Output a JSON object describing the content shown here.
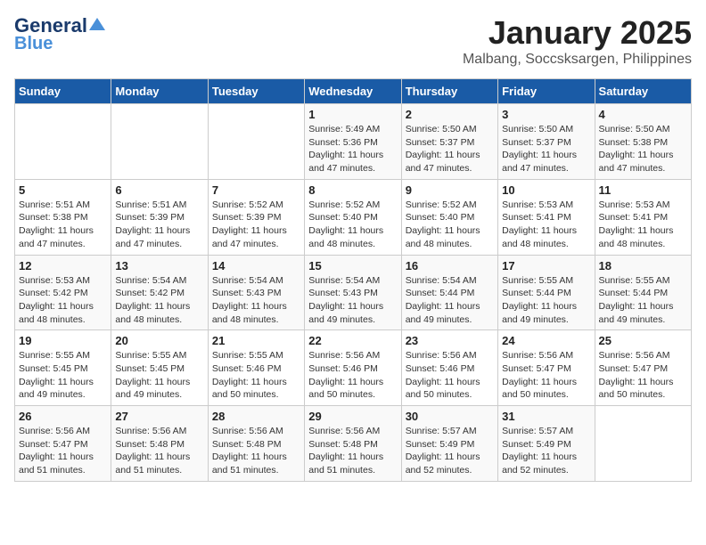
{
  "logo": {
    "part1": "General",
    "part2": "Blue"
  },
  "title": "January 2025",
  "subtitle": "Malbang, Soccsksargen, Philippines",
  "weekdays": [
    "Sunday",
    "Monday",
    "Tuesday",
    "Wednesday",
    "Thursday",
    "Friday",
    "Saturday"
  ],
  "weeks": [
    [
      {
        "day": "",
        "info": ""
      },
      {
        "day": "",
        "info": ""
      },
      {
        "day": "",
        "info": ""
      },
      {
        "day": "1",
        "info": "Sunrise: 5:49 AM\nSunset: 5:36 PM\nDaylight: 11 hours and 47 minutes."
      },
      {
        "day": "2",
        "info": "Sunrise: 5:50 AM\nSunset: 5:37 PM\nDaylight: 11 hours and 47 minutes."
      },
      {
        "day": "3",
        "info": "Sunrise: 5:50 AM\nSunset: 5:37 PM\nDaylight: 11 hours and 47 minutes."
      },
      {
        "day": "4",
        "info": "Sunrise: 5:50 AM\nSunset: 5:38 PM\nDaylight: 11 hours and 47 minutes."
      }
    ],
    [
      {
        "day": "5",
        "info": "Sunrise: 5:51 AM\nSunset: 5:38 PM\nDaylight: 11 hours and 47 minutes."
      },
      {
        "day": "6",
        "info": "Sunrise: 5:51 AM\nSunset: 5:39 PM\nDaylight: 11 hours and 47 minutes."
      },
      {
        "day": "7",
        "info": "Sunrise: 5:52 AM\nSunset: 5:39 PM\nDaylight: 11 hours and 47 minutes."
      },
      {
        "day": "8",
        "info": "Sunrise: 5:52 AM\nSunset: 5:40 PM\nDaylight: 11 hours and 48 minutes."
      },
      {
        "day": "9",
        "info": "Sunrise: 5:52 AM\nSunset: 5:40 PM\nDaylight: 11 hours and 48 minutes."
      },
      {
        "day": "10",
        "info": "Sunrise: 5:53 AM\nSunset: 5:41 PM\nDaylight: 11 hours and 48 minutes."
      },
      {
        "day": "11",
        "info": "Sunrise: 5:53 AM\nSunset: 5:41 PM\nDaylight: 11 hours and 48 minutes."
      }
    ],
    [
      {
        "day": "12",
        "info": "Sunrise: 5:53 AM\nSunset: 5:42 PM\nDaylight: 11 hours and 48 minutes."
      },
      {
        "day": "13",
        "info": "Sunrise: 5:54 AM\nSunset: 5:42 PM\nDaylight: 11 hours and 48 minutes."
      },
      {
        "day": "14",
        "info": "Sunrise: 5:54 AM\nSunset: 5:43 PM\nDaylight: 11 hours and 48 minutes."
      },
      {
        "day": "15",
        "info": "Sunrise: 5:54 AM\nSunset: 5:43 PM\nDaylight: 11 hours and 49 minutes."
      },
      {
        "day": "16",
        "info": "Sunrise: 5:54 AM\nSunset: 5:44 PM\nDaylight: 11 hours and 49 minutes."
      },
      {
        "day": "17",
        "info": "Sunrise: 5:55 AM\nSunset: 5:44 PM\nDaylight: 11 hours and 49 minutes."
      },
      {
        "day": "18",
        "info": "Sunrise: 5:55 AM\nSunset: 5:44 PM\nDaylight: 11 hours and 49 minutes."
      }
    ],
    [
      {
        "day": "19",
        "info": "Sunrise: 5:55 AM\nSunset: 5:45 PM\nDaylight: 11 hours and 49 minutes."
      },
      {
        "day": "20",
        "info": "Sunrise: 5:55 AM\nSunset: 5:45 PM\nDaylight: 11 hours and 49 minutes."
      },
      {
        "day": "21",
        "info": "Sunrise: 5:55 AM\nSunset: 5:46 PM\nDaylight: 11 hours and 50 minutes."
      },
      {
        "day": "22",
        "info": "Sunrise: 5:56 AM\nSunset: 5:46 PM\nDaylight: 11 hours and 50 minutes."
      },
      {
        "day": "23",
        "info": "Sunrise: 5:56 AM\nSunset: 5:46 PM\nDaylight: 11 hours and 50 minutes."
      },
      {
        "day": "24",
        "info": "Sunrise: 5:56 AM\nSunset: 5:47 PM\nDaylight: 11 hours and 50 minutes."
      },
      {
        "day": "25",
        "info": "Sunrise: 5:56 AM\nSunset: 5:47 PM\nDaylight: 11 hours and 50 minutes."
      }
    ],
    [
      {
        "day": "26",
        "info": "Sunrise: 5:56 AM\nSunset: 5:47 PM\nDaylight: 11 hours and 51 minutes."
      },
      {
        "day": "27",
        "info": "Sunrise: 5:56 AM\nSunset: 5:48 PM\nDaylight: 11 hours and 51 minutes."
      },
      {
        "day": "28",
        "info": "Sunrise: 5:56 AM\nSunset: 5:48 PM\nDaylight: 11 hours and 51 minutes."
      },
      {
        "day": "29",
        "info": "Sunrise: 5:56 AM\nSunset: 5:48 PM\nDaylight: 11 hours and 51 minutes."
      },
      {
        "day": "30",
        "info": "Sunrise: 5:57 AM\nSunset: 5:49 PM\nDaylight: 11 hours and 52 minutes."
      },
      {
        "day": "31",
        "info": "Sunrise: 5:57 AM\nSunset: 5:49 PM\nDaylight: 11 hours and 52 minutes."
      },
      {
        "day": "",
        "info": ""
      }
    ]
  ]
}
